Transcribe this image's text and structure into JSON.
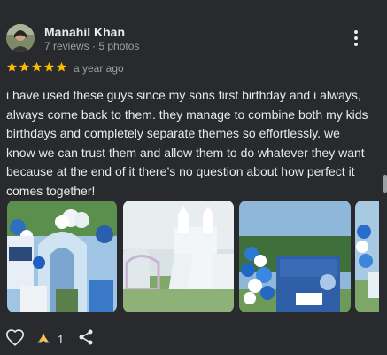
{
  "review": {
    "author_name": "Manahil Khan",
    "author_meta": "7 reviews · 5 photos",
    "rating": 5,
    "rating_max": 5,
    "star_color": "#fbbc04",
    "date": "a year ago",
    "text": "i have used these guys since my sons first birthday and i always, always come back to them. they manage to combine both my kids birthdays and completely separate themes so effortlessly. we know we can trust them and allow them to do whatever they want because at the end of it there’s no question about how perfect it comes together!",
    "photos": [
      {
        "icon": "party-decor-photo"
      },
      {
        "icon": "bouncy-castle-photo"
      },
      {
        "icon": "balloon-backdrop-photo"
      },
      {
        "icon": "partial-photo"
      }
    ],
    "reaction_count": "1"
  }
}
